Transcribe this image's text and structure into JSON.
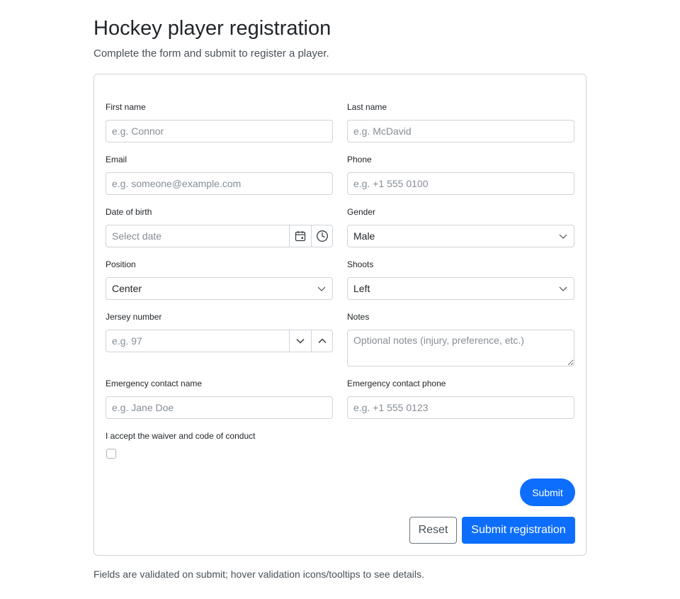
{
  "page": {
    "title": "Hockey player registration",
    "subtitle": "Complete the form and submit to register a player.",
    "footer_note": "Fields are validated on submit; hover validation icons/tooltips to see details."
  },
  "form": {
    "first_name": {
      "label": "First name",
      "placeholder": "e.g. Connor"
    },
    "last_name": {
      "label": "Last name",
      "placeholder": "e.g. McDavid"
    },
    "email": {
      "label": "Email",
      "placeholder": "e.g. someone@example.com"
    },
    "phone": {
      "label": "Phone",
      "placeholder": "e.g. +1 555 0100"
    },
    "date_of_birth": {
      "label": "Date of birth",
      "placeholder": "Select date",
      "calendar_icon": "calendar-icon",
      "clock_icon": "clock-icon"
    },
    "gender": {
      "label": "Gender",
      "value": "Male"
    },
    "position": {
      "label": "Position",
      "value": "Center"
    },
    "shoots": {
      "label": "Shoots",
      "value": "Left"
    },
    "jersey_number": {
      "label": "Jersey number",
      "placeholder": "e.g. 97",
      "decrement_icon": "chevron-down-icon",
      "increment_icon": "chevron-up-icon"
    },
    "notes": {
      "label": "Notes",
      "placeholder": "Optional notes (injury, preference, etc.)"
    },
    "emergency_name": {
      "label": "Emergency contact name",
      "placeholder": "e.g. Jane Doe"
    },
    "emergency_phone": {
      "label": "Emergency contact phone",
      "placeholder": "e.g. +1 555 0123"
    },
    "waiver": {
      "label": "I accept the waiver and code of conduct",
      "checked": false
    }
  },
  "actions": {
    "submit_label": "Submit",
    "reset_label": "Reset",
    "submit_registration_label": "Submit registration"
  },
  "colors": {
    "primary": "#0d6efd",
    "border": "#ced4da",
    "placeholder": "#868e96",
    "text": "#212529",
    "muted": "#495057"
  }
}
